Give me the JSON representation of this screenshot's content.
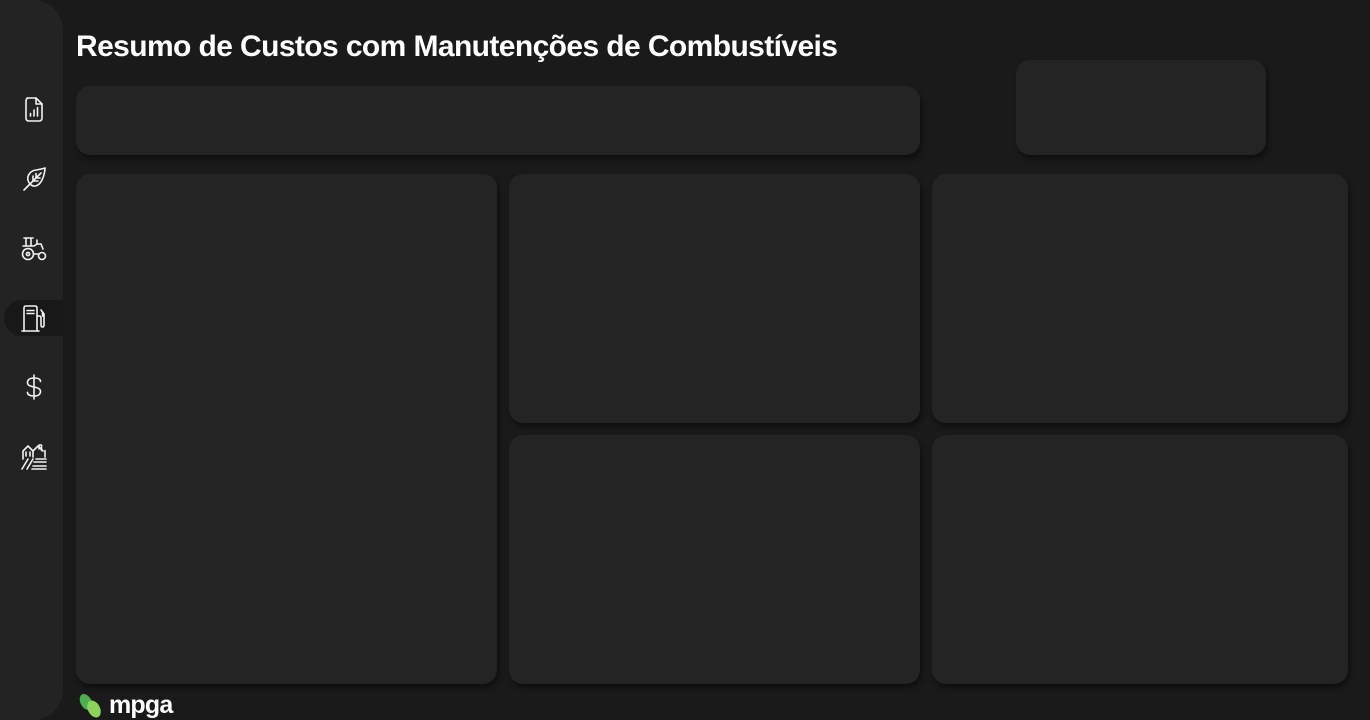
{
  "header": {
    "title": "Resumo de Custos com Manutenções de Combustíveis"
  },
  "sidebar": {
    "items": [
      {
        "icon": "report-document-icon",
        "active": false
      },
      {
        "icon": "leaf-icon",
        "active": false
      },
      {
        "icon": "tractor-icon",
        "active": false
      },
      {
        "icon": "fuel-pump-icon",
        "active": true
      },
      {
        "icon": "dollar-icon",
        "active": false
      },
      {
        "icon": "farm-field-icon",
        "active": false
      }
    ]
  },
  "brand": {
    "name": "mpga",
    "logo_colors": [
      "#4caf50",
      "#8bd35a"
    ]
  },
  "theme": {
    "background": "#1a1a1a",
    "sidebar": "#232323",
    "card": "#242424",
    "active_item": "#181818",
    "text": "#ffffff"
  }
}
